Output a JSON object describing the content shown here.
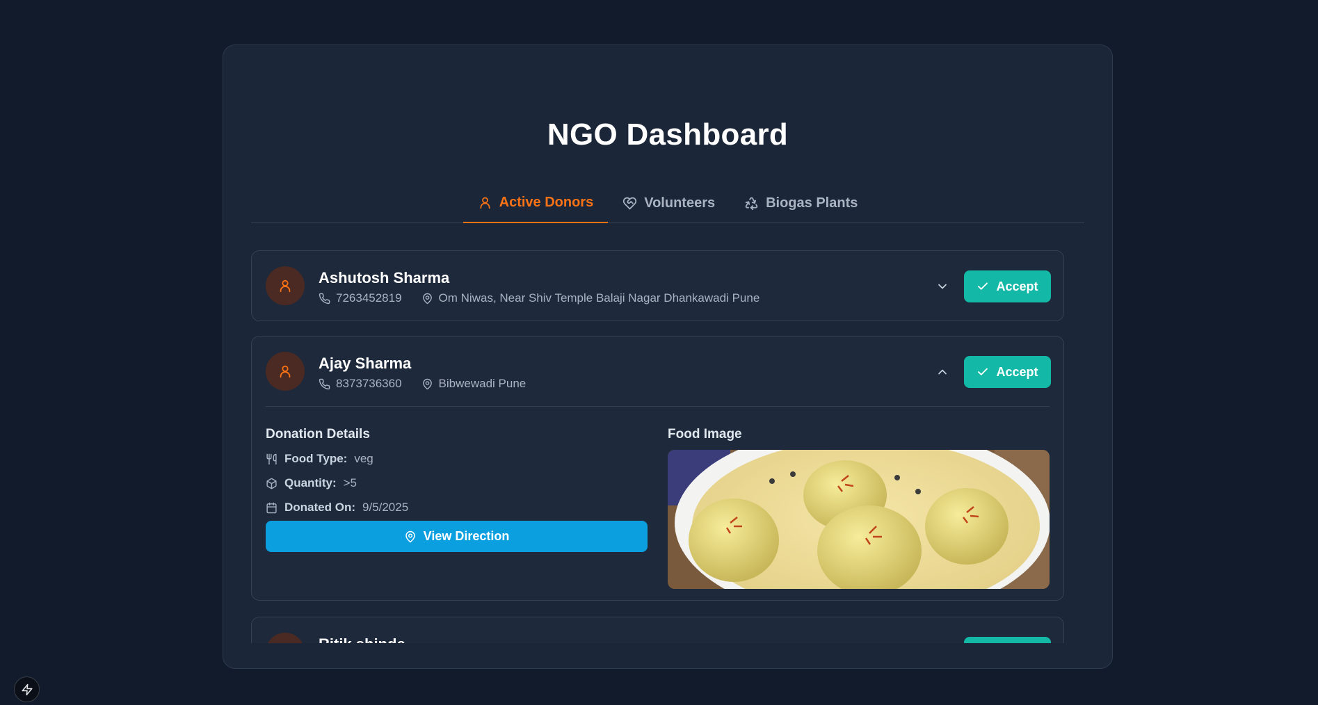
{
  "page": {
    "title": "NGO Dashboard"
  },
  "tabs": [
    {
      "label": "Active Donors",
      "icon": "user-icon",
      "active": true
    },
    {
      "label": "Volunteers",
      "icon": "heart-handshake-icon",
      "active": false
    },
    {
      "label": "Biogas Plants",
      "icon": "recycle-icon",
      "active": false
    }
  ],
  "donors": [
    {
      "name": "Ashutosh Sharma",
      "phone": "7263452819",
      "address": "Om Niwas, Near Shiv Temple Balaji Nagar Dhankawadi Pune",
      "expanded": false,
      "accept_label": "Accept"
    },
    {
      "name": "Ajay Sharma",
      "phone": "8373736360",
      "address": "Bibwewadi Pune",
      "expanded": true,
      "accept_label": "Accept",
      "details": {
        "heading": "Donation Details",
        "food_type_label": "Food Type:",
        "food_type": "veg",
        "quantity_label": "Quantity:",
        "quantity": ">5",
        "donated_on_label": "Donated On:",
        "donated_on": "9/5/2025",
        "direction_label": "View Direction",
        "image_heading": "Food Image"
      }
    },
    {
      "name": "Ritik shinde",
      "expanded": false
    }
  ],
  "colors": {
    "accent": "#f97316",
    "accept": "#14b8a6",
    "direction": "#0b9fe0",
    "background": "#111b2c",
    "card": "#1b2638"
  }
}
